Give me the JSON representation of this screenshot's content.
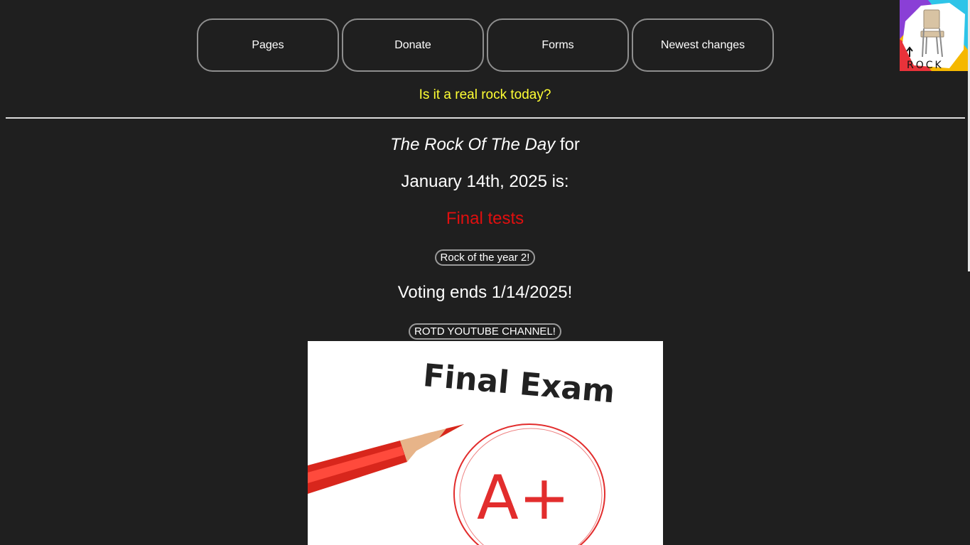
{
  "nav": {
    "items": [
      {
        "label": "Pages"
      },
      {
        "label": "Donate"
      },
      {
        "label": "Forms"
      },
      {
        "label": "Newest changes"
      }
    ]
  },
  "logo": {
    "text": "ROCK",
    "icon": "chair-logo-icon",
    "colors": [
      "#8a3fd6",
      "#2ec4e8",
      "#f5b800",
      "#e8323a"
    ]
  },
  "subtitle": {
    "link_text": "Is it a real rock today?",
    "color": "#ffff33"
  },
  "rotd": {
    "title_italic": "The Rock Of The Day",
    "title_suffix": " for",
    "date_line": "January 14th, 2025 is:",
    "rock_name": "Final tests",
    "rock_name_color": "#e00f0f",
    "rock_of_year_button": "Rock of the year 2!",
    "voting_text": "Voting ends 1/14/2025!",
    "youtube_button": "ROTD YOUTUBE CHANNEL!"
  },
  "image": {
    "caption_text": "Final Exam",
    "grade_text": "A+"
  }
}
